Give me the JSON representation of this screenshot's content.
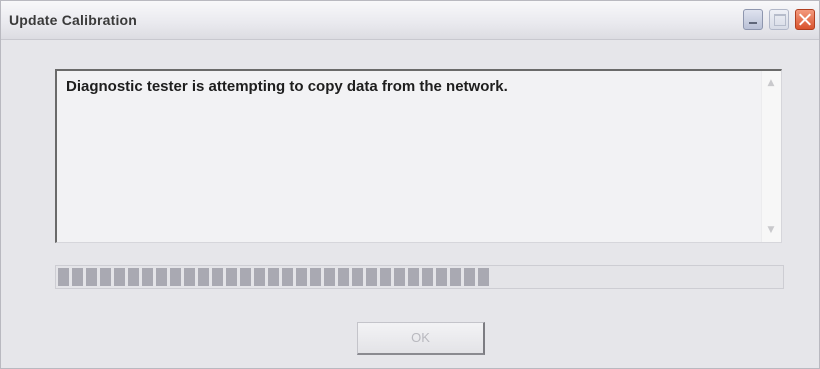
{
  "window": {
    "title": "Update Calibration"
  },
  "title_buttons": {
    "minimize_icon": "minimize-icon",
    "maximize_icon": "maximize-icon",
    "close_icon": "close-icon",
    "close_color": "#d9532e"
  },
  "message": {
    "text": "Diagnostic tester is attempting to copy data from the network.",
    "scroll_up_glyph": "▲",
    "scroll_down_glyph": "▼"
  },
  "progress": {
    "value_percent": 60
  },
  "ok_button": {
    "label": "OK",
    "enabled": false
  }
}
